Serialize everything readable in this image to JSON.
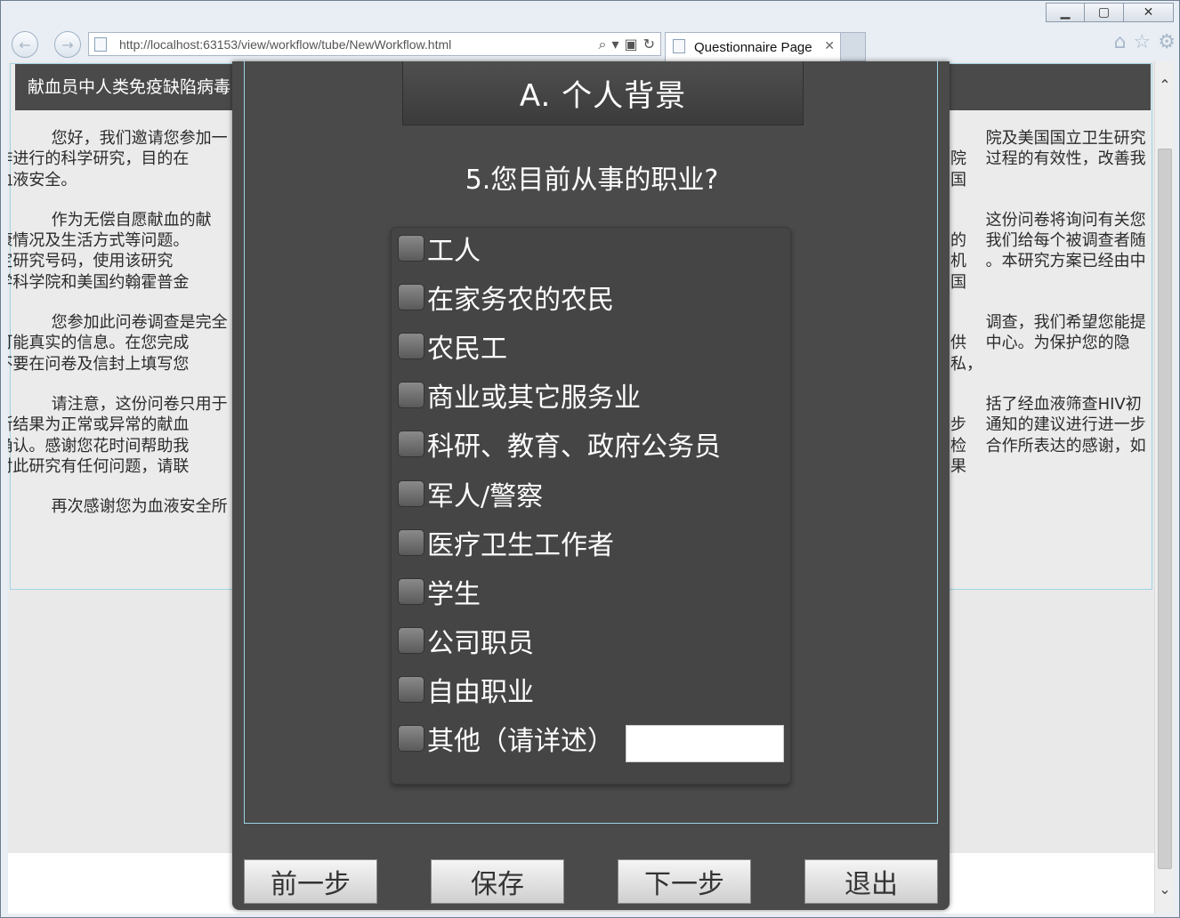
{
  "browser": {
    "url": "http://localhost:63153/view/workflow/tube/NewWorkflow.html",
    "tab_title": "Questionnaire Page",
    "tab_close": "✕",
    "back_glyph": "←",
    "forward_glyph": "→",
    "icons": [
      "search-icon",
      "dropdown-icon",
      "compatibility-icon",
      "refresh-icon",
      "home-icon",
      "favorites-star-icon",
      "settings-gear-icon"
    ]
  },
  "consent": {
    "header": "献血员中人类免疫缺陷病毒",
    "paragraphs": [
      {
        "left": "您好，我们邀请您参加一",
        "right": "院及美国国立卫生研究院",
        "line2_left": "合作进行的科学研究，目的在",
        "line2_right": "过程的有效性，改善我国",
        "line3_left": "的血液安全。"
      },
      {
        "left": "作为无偿自愿献血的献",
        "right": "这份问卷将询问有关您的",
        "line2_left": "健康情况及生活方式等问题。",
        "line2_right": "我们给每个被调查者随机",
        "line3_left": "指定研究号码，使用该研究",
        "line3_right": "。本研究方案已经由中国",
        "line4_left": "医学科学院和美国约翰霍普金"
      },
      {
        "left": "您参加此问卷调查是完全",
        "right": "调查，我们希望您能提供",
        "line2_left": "尽可能真实的信息。在您完成",
        "line2_right": "中心。为保护您的隐私，",
        "line3_left": "请不要在问卷及信封上填写您"
      },
      {
        "left": "请注意，这份问卷只用于",
        "right": "括了经血液筛查HIV初步",
        "line2_left": "判断结果为正常或异常的献血",
        "line2_right": "通知的建议进行进一步检",
        "line3_left": "查确认。感谢您花时间帮助我",
        "line3_right": "合作所表达的感谢，如果",
        "line4_left": "您对此研究有任何问题，请联"
      },
      {
        "left": "再次感谢您为血液安全所"
      }
    ]
  },
  "modal": {
    "section_title": "A. 个人背景",
    "question": "5.您目前从事的职业?",
    "options": [
      {
        "label": "工人",
        "checked": false
      },
      {
        "label": "在家务农的农民",
        "checked": false
      },
      {
        "label": "农民工",
        "checked": false
      },
      {
        "label": "商业或其它服务业",
        "checked": false
      },
      {
        "label": "科研、教育、政府公务员",
        "checked": false
      },
      {
        "label": "军人/警察",
        "checked": false
      },
      {
        "label": "医疗卫生工作者",
        "checked": false
      },
      {
        "label": "学生",
        "checked": false
      },
      {
        "label": "公司职员",
        "checked": false
      },
      {
        "label": "自由职业",
        "checked": false
      },
      {
        "label": "其他（请详述）",
        "checked": false
      }
    ],
    "other_value": "",
    "buttons": {
      "prev": "前一步",
      "save": "保存",
      "next": "下一步",
      "exit": "退出"
    }
  },
  "colors": {
    "modal_bg": "#4a4a4a",
    "accent_border": "#9ed3e6",
    "page_bg": "#e9e9e9"
  }
}
